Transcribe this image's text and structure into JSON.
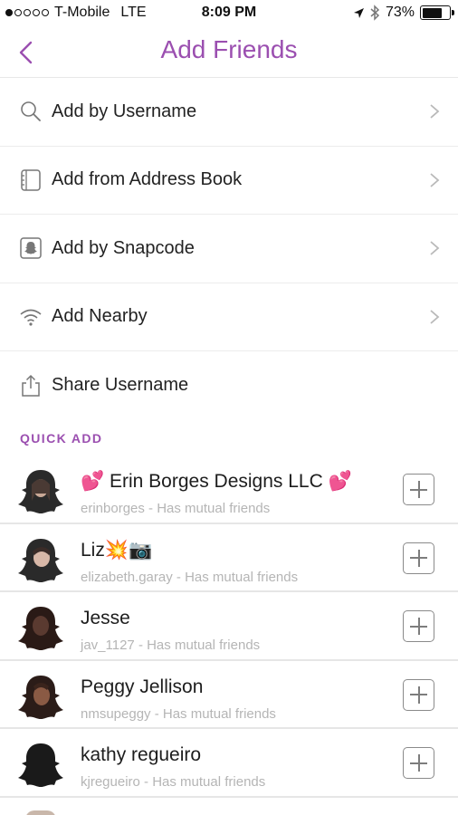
{
  "status_bar": {
    "carrier": "T-Mobile",
    "network": "LTE",
    "time": "8:09 PM",
    "battery": "73%",
    "battery_level": 0.73
  },
  "header": {
    "title": "Add Friends"
  },
  "menu": [
    {
      "label": "Add by Username",
      "icon": "search-icon"
    },
    {
      "label": "Add from Address Book",
      "icon": "address-book-icon"
    },
    {
      "label": "Add by Snapcode",
      "icon": "snapcode-icon"
    },
    {
      "label": "Add Nearby",
      "icon": "wifi-icon"
    },
    {
      "label": "Share Username",
      "icon": "share-icon"
    }
  ],
  "quick_add": {
    "title": "QUICK ADD",
    "friends": [
      {
        "name": "💕 Erin Borges Designs LLC 💕",
        "username": "erinborges",
        "detail": "Has mutual friends",
        "sub": "erinborges - Has mutual friends"
      },
      {
        "name": "Liz💥📷",
        "username": "elizabeth.garay",
        "detail": "Has mutual friends",
        "sub": "elizabeth.garay - Has mutual friends"
      },
      {
        "name": "Jesse",
        "username": "jav_1127",
        "detail": "Has mutual friends",
        "sub": "jav_1127 - Has mutual friends"
      },
      {
        "name": "Peggy Jellison",
        "username": "nmsupeggy",
        "detail": "Has mutual friends",
        "sub": "nmsupeggy - Has mutual friends"
      },
      {
        "name": "kathy regueiro",
        "username": "kjregueiro",
        "detail": "Has mutual friends",
        "sub": "kjregueiro - Has mutual friends"
      }
    ]
  },
  "colors": {
    "accent": "#9b4fb0",
    "secondary_text": "#b5b5b5"
  }
}
